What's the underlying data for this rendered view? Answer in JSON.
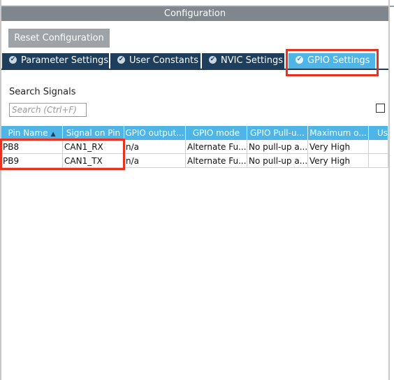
{
  "header": {
    "title": "Configuration"
  },
  "toolbar": {
    "reset_label": "Reset Configuration"
  },
  "tabs": [
    {
      "label": "Parameter Settings",
      "active": false
    },
    {
      "label": "User Constants",
      "active": false
    },
    {
      "label": "NVIC Settings",
      "active": false
    },
    {
      "label": "GPIO Settings",
      "active": true
    }
  ],
  "search": {
    "label": "Search Signals",
    "placeholder": "Search (Ctrl+F)",
    "value": ""
  },
  "table": {
    "columns": [
      "Pin Name",
      "Signal on Pin",
      "GPIO output...",
      "GPIO mode",
      "GPIO Pull-u...",
      "Maximum o...",
      "Us"
    ],
    "rows": [
      [
        "PB8",
        "CAN1_RX",
        "n/a",
        "Alternate Fu...",
        "No pull-up a...",
        "Very High",
        ""
      ],
      [
        "PB9",
        "CAN1_TX",
        "n/a",
        "Alternate Fu...",
        "No pull-up a...",
        "Very High",
        ""
      ]
    ]
  },
  "colors": {
    "header_bg": "#7f868c",
    "tab_bg": "#1e3e5c",
    "active_tab_bg": "#4fb4e6",
    "highlight": "#e8311f"
  }
}
